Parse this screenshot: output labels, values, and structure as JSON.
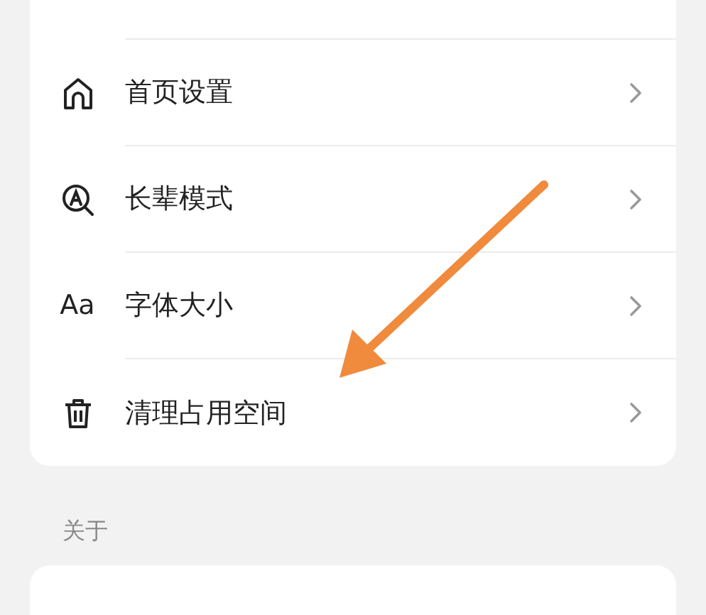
{
  "groups": [
    {
      "items": [
        {
          "kind": "home",
          "label": "首页设置"
        },
        {
          "kind": "elder",
          "label": "长辈模式"
        },
        {
          "kind": "text",
          "icon_text": "Aa",
          "label": "字体大小"
        },
        {
          "kind": "trash",
          "label": "清理占用空间"
        }
      ]
    },
    {
      "title": "关于"
    }
  ]
}
